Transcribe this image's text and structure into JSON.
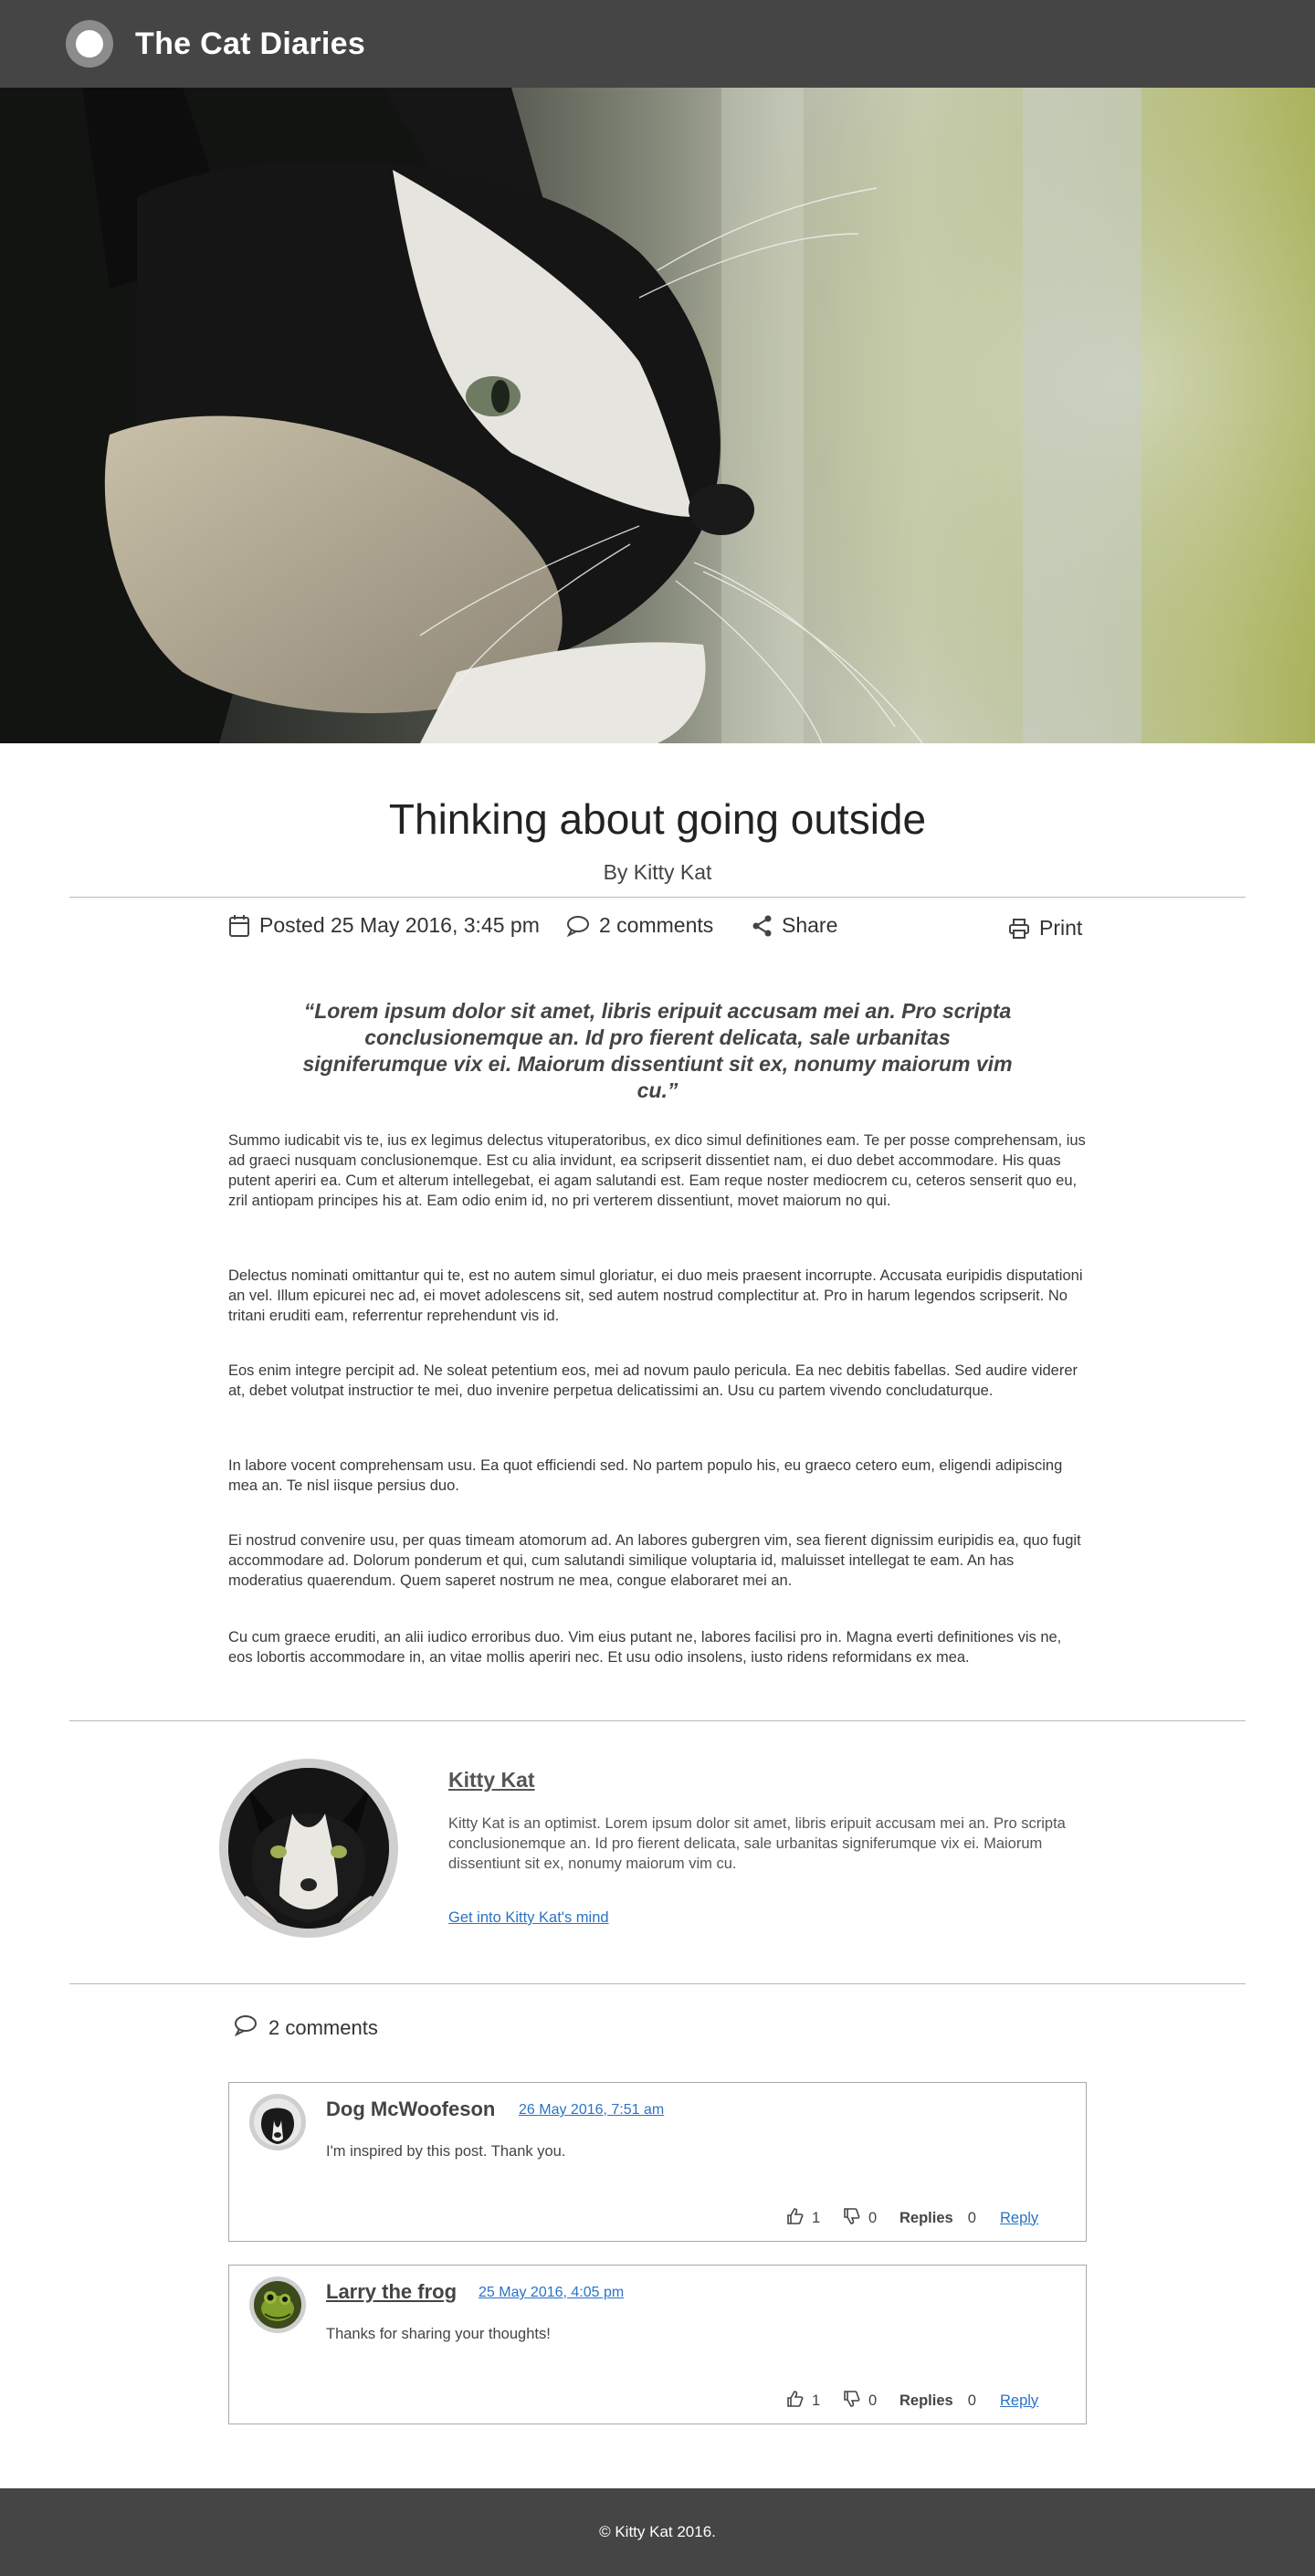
{
  "site": {
    "title": "The Cat Diaries"
  },
  "article": {
    "title": "Thinking about going outside",
    "byline": "By Kitty Kat",
    "posted": "Posted 25 May 2016, 3:45 pm",
    "comments_count": "2 comments",
    "share": "Share",
    "print": "Print",
    "quote": "“Lorem ipsum dolor sit amet, libris eripuit accusam mei an. Pro scripta conclusionemque an. Id pro fierent delicata, sale urbanitas signiferumque vix ei. Maiorum dissentiunt sit ex, nonumy maiorum vim cu.”",
    "paragraphs": [
      "Summo iudicabit vis te, ius ex legimus delectus vituperatoribus, ex dico simul definitiones eam. Te per posse comprehensam, ius ad graeci nusquam conclusionemque. Est cu alia invidunt, ea scripserit dissentiet nam, ei duo debet accommodare. His quas putent aperiri ea. Cum et alterum intellegebat, ei agam salutandi est. Eam reque noster mediocrem cu, ceteros senserit quo eu, zril antiopam principes his at. Eam odio enim id, no pri verterem dissentiunt, movet maiorum no qui.",
      "Delectus nominati omittantur qui te, est no autem simul gloriatur, ei duo meis praesent incorrupte. Accusata euripidis disputationi an vel. Illum epicurei nec ad, ei movet adolescens sit, sed autem nostrud complectitur at. Pro in harum legendos scripserit. No tritani eruditi eam, referrentur reprehendunt vis id.",
      "Eos enim integre percipit ad. Ne soleat petentium eos, mei ad novum paulo pericula. Ea nec debitis fabellas. Sed audire viderer at, debet volutpat instructior te mei, duo invenire perpetua delicatissimi an. Usu cu partem vivendo concludaturque.",
      "In labore vocent comprehensam usu. Ea quot efficiendi sed. No partem populo his, eu graeco cetero eum, eligendi adipiscing mea an. Te nisl iisque persius duo.",
      "Ei nostrud convenire usu, per quas timeam atomorum ad. An labores gubergren vim, sea fierent dignissim euripidis ea, quo fugit accommodare ad. Dolorum ponderum et qui, cum salutandi similique voluptaria id, maluisset intellegat te eam. An has moderatius quaerendum. Quem saperet nostrum ne mea, congue elaboraret mei an.",
      "Cu cum graece eruditi, an alii iudico erroribus duo. Vim eius putant ne, labores facilisi pro in. Magna everti definitiones vis ne, eos lobortis accommodare in, an vitae mollis aperiri nec. Et usu odio insolens, iusto ridens reformidans ex mea."
    ]
  },
  "author": {
    "name": "Kitty Kat",
    "bio": "Kitty Kat is an optimist. Lorem ipsum dolor sit amet, libris eripuit accusam mei an. Pro scripta conclusionemque an. Id pro fierent delicata, sale urbanitas signiferumque vix ei. Maiorum dissentiunt sit ex, nonumy maiorum vim cu.",
    "link": "Get into Kitty Kat's mind"
  },
  "comments": {
    "heading": "2 comments",
    "items": [
      {
        "name": "Dog McWoofeson",
        "date": "26 May 2016, 7:51 am",
        "text": "I'm inspired by this post. Thank you.",
        "likes": "1",
        "dislikes": "0",
        "replies_label": "Replies",
        "replies": "0",
        "reply": "Reply"
      },
      {
        "name": "Larry the frog",
        "date": "25 May 2016, 4:05 pm",
        "text": "Thanks for sharing your thoughts!",
        "likes": "1",
        "dislikes": "0",
        "replies_label": "Replies",
        "replies": "0",
        "reply": "Reply"
      }
    ]
  },
  "footer": {
    "text": "© Kitty Kat 2016."
  },
  "icons": {
    "logo": "logo-circle-icon",
    "calendar": "calendar-icon",
    "comment": "speech-bubble-icon",
    "share": "share-icon",
    "print": "printer-icon",
    "like": "thumbs-up-icon",
    "dislike": "thumbs-down-icon"
  },
  "colors": {
    "header_bg": "#454545",
    "link": "#2a73c7",
    "rule": "#b9b9b9",
    "comment_border": "#a9a9a9"
  }
}
